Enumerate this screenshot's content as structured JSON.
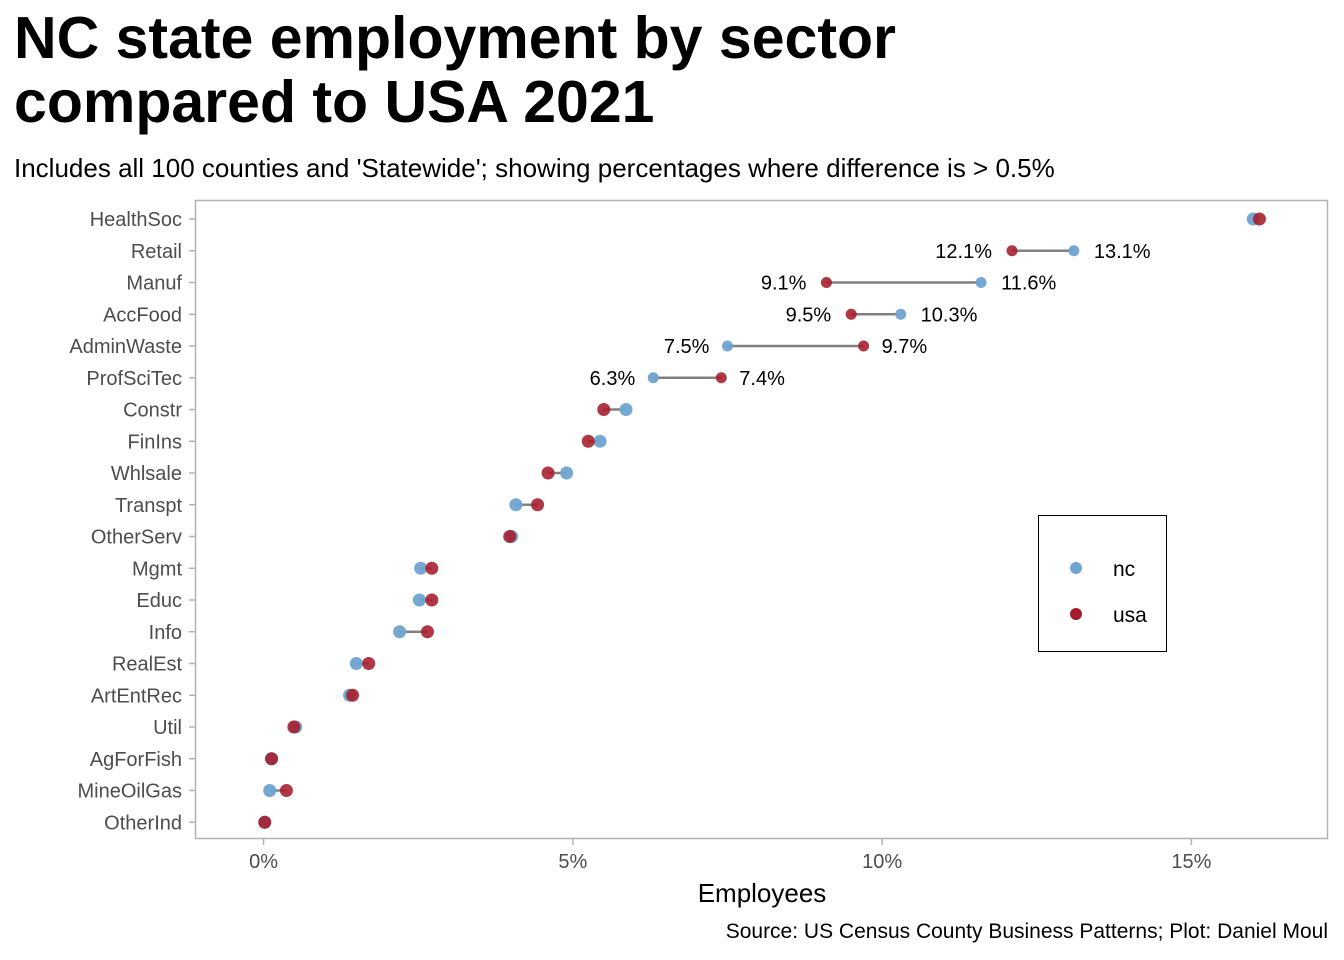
{
  "title_lines": [
    "NC state employment by sector",
    "compared to USA 2021"
  ],
  "subtitle": "Includes all 100 counties and 'Statewide'; showing percentages where difference is > 0.5%",
  "caption": "Source: US Census County Business Patterns; Plot: Daniel Moul",
  "colors": {
    "nc": "#6fa3d2",
    "usa": "#a51b29",
    "segment": "#808080"
  },
  "chart_data": {
    "type": "scatter",
    "subtype": "dumbbell",
    "title": "NC state employment by sector compared to USA 2021",
    "xlabel": "Employees",
    "ylabel": "",
    "xlim": [
      -1.1,
      17.2
    ],
    "xticks": [
      0,
      5,
      10,
      15
    ],
    "xtick_labels": [
      "0%",
      "5%",
      "10%",
      "15%"
    ],
    "grid": false,
    "legend": {
      "position": "right",
      "entries": [
        "nc",
        "usa"
      ]
    },
    "categories": [
      "HealthSoc",
      "Retail",
      "Manuf",
      "AccFood",
      "AdminWaste",
      "ProfSciTec",
      "Constr",
      "FinIns",
      "Whlsale",
      "Transpt",
      "OtherServ",
      "Mgmt",
      "Educ",
      "Info",
      "RealEst",
      "ArtEntRec",
      "Util",
      "AgForFish",
      "MineOilGas",
      "OtherInd"
    ],
    "series": [
      {
        "name": "nc",
        "values": [
          16.0,
          13.1,
          11.6,
          10.3,
          7.5,
          6.3,
          5.86,
          5.44,
          4.9,
          4.08,
          4.01,
          2.54,
          2.52,
          2.2,
          1.5,
          1.39,
          0.52,
          0.13,
          0.1,
          0.02
        ]
      },
      {
        "name": "usa",
        "values": [
          16.1,
          12.1,
          9.1,
          9.5,
          9.7,
          7.4,
          5.5,
          5.25,
          4.6,
          4.43,
          3.98,
          2.72,
          2.72,
          2.65,
          1.7,
          1.44,
          0.49,
          0.13,
          0.37,
          0.02
        ]
      }
    ],
    "annotations": [
      {
        "category": "Retail",
        "nc": "13.1%",
        "usa": "12.1%"
      },
      {
        "category": "Manuf",
        "nc": "11.6%",
        "usa": "9.1%"
      },
      {
        "category": "AccFood",
        "nc": "10.3%",
        "usa": "9.5%"
      },
      {
        "category": "AdminWaste",
        "nc": "7.5%",
        "usa": "9.7%"
      },
      {
        "category": "ProfSciTec",
        "nc": "6.3%",
        "usa": "7.4%"
      }
    ]
  }
}
